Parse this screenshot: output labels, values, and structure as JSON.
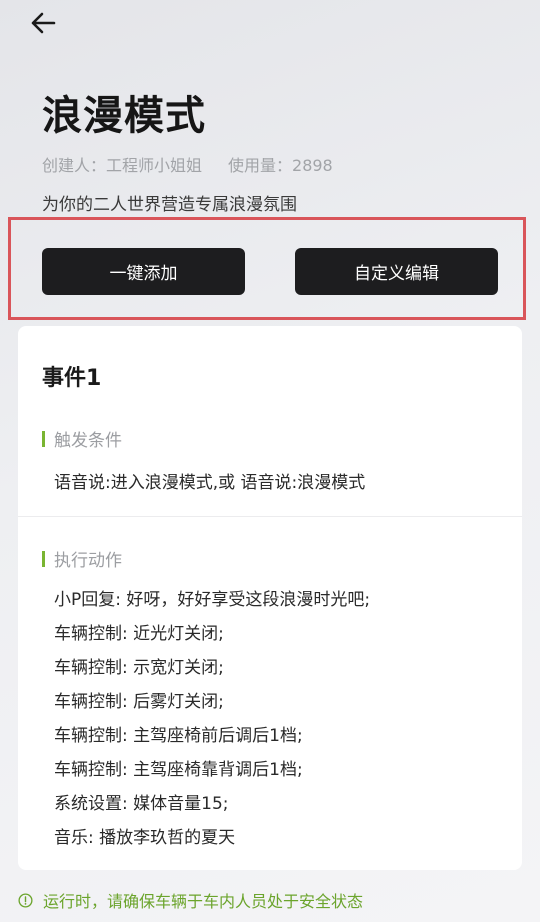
{
  "header": {
    "title": "浪漫模式",
    "creator": "创建人：工程师小姐姐",
    "usage": "使用量：2898",
    "description": "为你的二人世界营造专属浪漫氛围"
  },
  "buttons": {
    "add": "一键添加",
    "edit": "自定义编辑"
  },
  "event": {
    "title": "事件1",
    "trigger_label": "触发条件",
    "trigger_text": "语音说:进入浪漫模式,或 语音说:浪漫模式",
    "action_label": "执行动作",
    "actions": [
      "小P回复: 好呀，好好享受这段浪漫时光吧;",
      "车辆控制: 近光灯关闭;",
      "车辆控制: 示宽灯关闭;",
      "车辆控制: 后雾灯关闭;",
      "车辆控制: 主驾座椅前后调后1档;",
      "车辆控制: 主驾座椅靠背调后1档;",
      "系统设置: 媒体音量15;",
      "音乐: 播放李玖哲的夏天"
    ]
  },
  "notice": "运行时，请确保车辆于车内人员处于安全状态",
  "colors": {
    "accent_green": "#7ab532",
    "highlight_red": "#d9555a",
    "button_dark": "#1d1d1f"
  }
}
